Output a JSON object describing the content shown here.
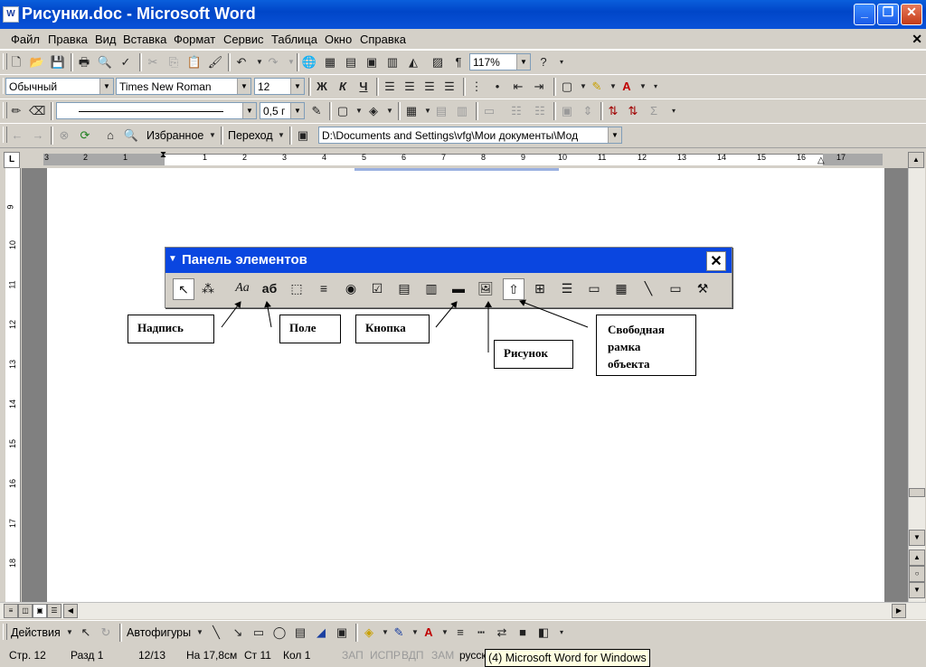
{
  "window": {
    "title": "Рисунки.doc - Microsoft Word",
    "app_icon": "W"
  },
  "menu": [
    "Файл",
    "Правка",
    "Вид",
    "Вставка",
    "Формат",
    "Сервис",
    "Таблица",
    "Окно",
    "Справка"
  ],
  "standard_toolbar": {
    "zoom": "117%"
  },
  "format_toolbar": {
    "style": "Обычный",
    "font": "Times New Roman",
    "size": "12",
    "bold": "Ж",
    "italic": "К",
    "underline": "Ч"
  },
  "drawing_line_toolbar": {
    "line_weight": "0,5 г"
  },
  "web_toolbar": {
    "favorites": "Избранное",
    "go": "Переход",
    "address": "D:\\Documents and Settings\\vfg\\Мои документы\\Мод"
  },
  "ruler": {
    "h_numbers": [
      "3",
      "2",
      "1",
      "1",
      "2",
      "3",
      "4",
      "5",
      "6",
      "7",
      "8",
      "9",
      "10",
      "11",
      "12",
      "13",
      "14",
      "15",
      "16",
      "17"
    ],
    "v_numbers": [
      "9",
      "10",
      "11",
      "12",
      "13",
      "14",
      "15",
      "16",
      "17",
      "18"
    ]
  },
  "panel": {
    "title": "Панель элементов"
  },
  "callouts": {
    "label": "Надпись",
    "field": "Поле",
    "button": "Кнопка",
    "picture": "Рисунок",
    "free_frame_1": "Свободная",
    "free_frame_2": "рамка",
    "free_frame_3": "объекта"
  },
  "draw_toolbar": {
    "actions": "Действия",
    "autoshapes": "Автофигуры"
  },
  "status": {
    "page": "Стр. 12",
    "section": "Разд 1",
    "pages": "12/13",
    "at": "На 17,8см",
    "line": "Ст 11",
    "col": "Кол 1",
    "rec": "ЗАП",
    "trk": "ИСПР",
    "ext": "ВДП",
    "ovr": "ЗАМ",
    "lang": "русск"
  },
  "tooltip": "(4) Microsoft Word for Windows"
}
